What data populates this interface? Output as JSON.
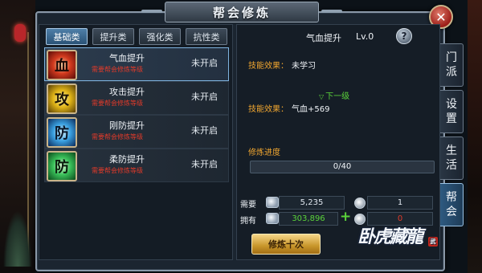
{
  "window": {
    "title": "帮会修炼"
  },
  "close": {
    "icon": "close-icon",
    "glyph": "✕"
  },
  "tabs": [
    {
      "label": "基础类",
      "active": true
    },
    {
      "label": "提升类",
      "active": false
    },
    {
      "label": "强化类",
      "active": false
    },
    {
      "label": "抗性类",
      "active": false
    }
  ],
  "skills": [
    {
      "glyph": "血",
      "name": "气血提升",
      "requirement": "需要帮会修炼等级",
      "status": "未开启",
      "selected": true
    },
    {
      "glyph": "攻",
      "name": "攻击提升",
      "requirement": "需要帮会修炼等级",
      "status": "未开启",
      "selected": false
    },
    {
      "glyph": "防",
      "name": "刚防提升",
      "requirement": "需要帮会修炼等级",
      "status": "未开启",
      "selected": false
    },
    {
      "glyph": "防",
      "name": "柔防提升",
      "requirement": "需要帮会修炼等级",
      "status": "未开启",
      "selected": false
    }
  ],
  "detail": {
    "name": "气血提升",
    "level": "Lv.0",
    "help_glyph": "?",
    "effect_label": "技能效果：",
    "effect_value": "未学习",
    "next_level": "下一级",
    "next_effect_label": "技能效果：",
    "next_effect_value": "气血+569",
    "progress_label": "修炼进度",
    "progress_text": "0/40",
    "progress_fraction": 0.0
  },
  "resources": {
    "need_label": "需要",
    "need_value": "5,235",
    "need_gem_value": "1",
    "have_label": "拥有",
    "have_value": "303,896",
    "have_gem_value": "0",
    "plus_glyph": "+"
  },
  "buttons": {
    "train_ten": "修炼十次"
  },
  "side_tabs": [
    {
      "chars": [
        "门",
        "派"
      ],
      "active": false
    },
    {
      "chars": [
        "设",
        "置"
      ],
      "active": false
    },
    {
      "chars": [
        "生",
        "活"
      ],
      "active": false
    },
    {
      "chars": [
        "帮",
        "会"
      ],
      "active": true
    }
  ],
  "logo": {
    "text": "卧虎藏龍",
    "seal": "武"
  },
  "colors": {
    "effect_label": "#f0a630",
    "requirement": "#e03a2a",
    "next_level": "#5ad23a",
    "need_value": "#dfe6ee",
    "have_value": "#5ad23a",
    "gem_have": "#e03a2a"
  }
}
